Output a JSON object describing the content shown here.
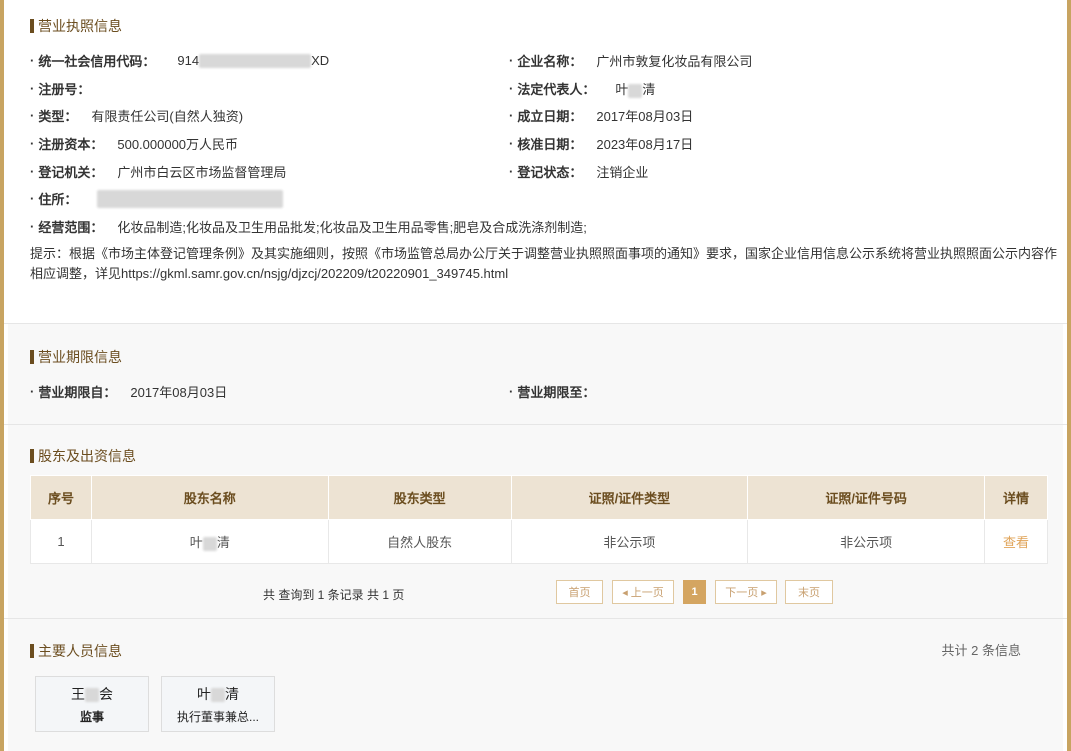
{
  "license": {
    "title": "营业执照信息",
    "credit_code_label": "统一社会信用代码：",
    "credit_code_prefix": "914",
    "credit_code_suffix": "XD",
    "company_name_label": "企业名称：",
    "company_name": "广州市敦复化妆品有限公司",
    "reg_no_label": "注册号：",
    "legal_rep_label": "法定代表人：",
    "legal_rep_first": "叶",
    "legal_rep_last": "清",
    "type_label": "类型：",
    "type": "有限责任公司(自然人独资)",
    "founded_label": "成立日期：",
    "founded": "2017年08月03日",
    "capital_label": "注册资本：",
    "capital": "500.000000万人民币",
    "approved_label": "核准日期：",
    "approved": "2023年08月17日",
    "authority_label": "登记机关：",
    "authority": "广州市白云区市场监督管理局",
    "status_label": "登记状态：",
    "status": "注销企业",
    "address_label": "住所：",
    "scope_label": "经营范围：",
    "scope": "化妆品制造;化妆品及卫生用品批发;化妆品及卫生用品零售;肥皂及合成洗涤剂制造;",
    "tip": "提示：根据《市场主体登记管理条例》及其实施细则，按照《市场监管总局办公厅关于调整营业执照照面事项的通知》要求，国家企业信用信息公示系统将营业执照照面公示内容作相应调整，详见https://gkml.samr.gov.cn/nsjg/djzcj/202209/t20220901_349745.html"
  },
  "term": {
    "title": "营业期限信息",
    "from_label": "营业期限自：",
    "from": "2017年08月03日",
    "to_label": "营业期限至："
  },
  "shareholders": {
    "title": "股东及出资信息",
    "columns": [
      "序号",
      "股东名称",
      "股东类型",
      "证照/证件类型",
      "证照/证件号码",
      "详情"
    ],
    "rows": [
      {
        "no": "1",
        "name_first": "叶",
        "name_last": "清",
        "type": "自然人股东",
        "id_type": "非公示项",
        "id_no": "非公示项",
        "detail": "查看"
      }
    ],
    "pager_info": "共 查询到 1 条记录 共 1 页",
    "first": "首页",
    "prev": "◂ 上一页",
    "current": "1",
    "next": "下一页 ▸",
    "last": "末页"
  },
  "personnel": {
    "title": "主要人员信息",
    "count": "共计 2 条信息",
    "people": [
      {
        "name_first": "王",
        "name_last": "会",
        "role": "监事"
      },
      {
        "name_first": "叶",
        "name_last": "清",
        "role": "执行董事兼总..."
      }
    ]
  },
  "colors": {
    "accent_border": "#c8a461",
    "title_brown": "#6b4d1f",
    "table_header_bg": "#ede3d3",
    "link_orange": "#e0a45a",
    "pager_active": "#d4a561"
  }
}
